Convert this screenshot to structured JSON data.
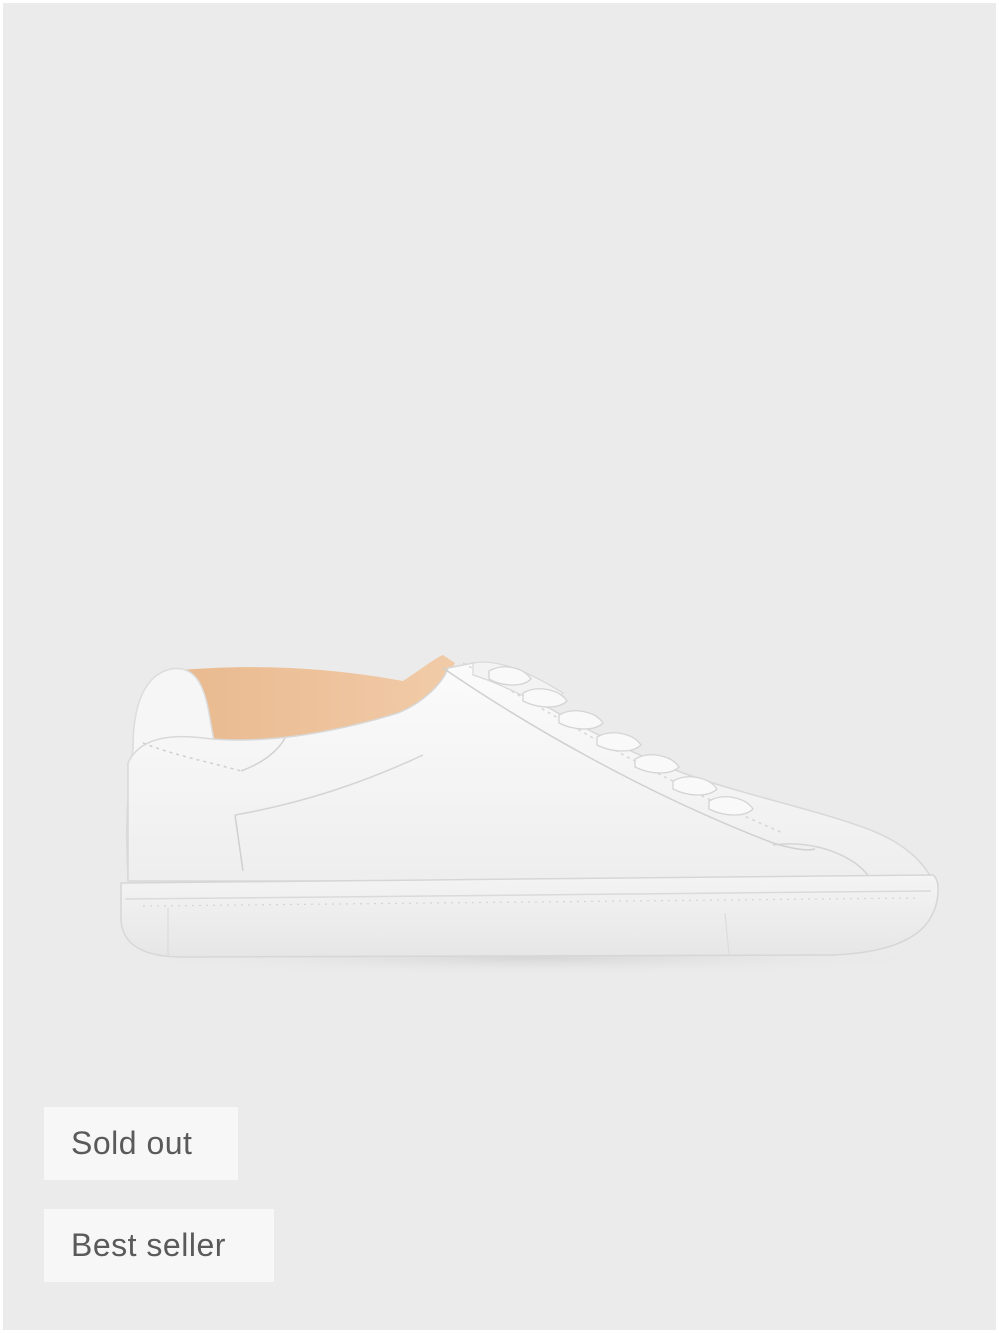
{
  "product": {
    "image_subject": "white leather low-top sneaker",
    "background_color": "#ebebeb",
    "badges": {
      "sold_out": "Sold out",
      "best_seller": "Best seller"
    }
  }
}
